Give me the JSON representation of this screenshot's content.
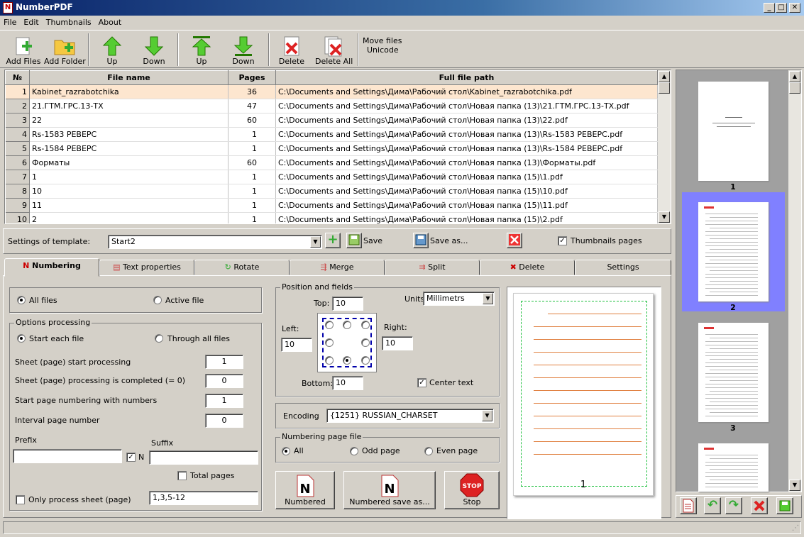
{
  "window": {
    "title": "NumberPDF",
    "min": "_",
    "max": "□",
    "close": "✕"
  },
  "menu": [
    "File",
    "Edit",
    "Thumbnails",
    "About"
  ],
  "toolbar": {
    "add_files": "Add Files",
    "add_folder": "Add Folder",
    "up1": "Up",
    "down1": "Down",
    "up2": "Up",
    "down2": "Down",
    "delete": "Delete",
    "delete_all": "Delete All",
    "move_files": "Move files",
    "unicode": "Unicode"
  },
  "grid": {
    "headers": [
      "№",
      "File name",
      "Pages",
      "Full file path"
    ],
    "rows": [
      [
        "1",
        "Kabinet_razrabotchika",
        "36",
        "C:\\Documents and Settings\\Дима\\Рабочий стол\\Kabinet_razrabotchika.pdf"
      ],
      [
        "2",
        "21.ГТМ.ГРС.13-ТХ",
        "47",
        "C:\\Documents and Settings\\Дима\\Рабочий стол\\Новая папка (13)\\21.ГТМ.ГРС.13-ТХ.pdf"
      ],
      [
        "3",
        "22",
        "60",
        "C:\\Documents and Settings\\Дима\\Рабочий стол\\Новая папка (13)\\22.pdf"
      ],
      [
        "4",
        "Rs-1583 РЕВЕРС",
        "1",
        "C:\\Documents and Settings\\Дима\\Рабочий стол\\Новая папка (13)\\Rs-1583 РЕВЕРС.pdf"
      ],
      [
        "5",
        "Rs-1584 РЕВЕРС",
        "1",
        "C:\\Documents and Settings\\Дима\\Рабочий стол\\Новая папка (13)\\Rs-1584 РЕВЕРС.pdf"
      ],
      [
        "6",
        "Форматы",
        "60",
        "C:\\Documents and Settings\\Дима\\Рабочий стол\\Новая папка (13)\\Форматы.pdf"
      ],
      [
        "7",
        "1",
        "1",
        "C:\\Documents and Settings\\Дима\\Рабочий стол\\Новая папка (15)\\1.pdf"
      ],
      [
        "8",
        "10",
        "1",
        "C:\\Documents and Settings\\Дима\\Рабочий стол\\Новая папка (15)\\10.pdf"
      ],
      [
        "9",
        "11",
        "1",
        "C:\\Documents and Settings\\Дима\\Рабочий стол\\Новая папка (15)\\11.pdf"
      ],
      [
        "10",
        "2",
        "1",
        "C:\\Documents and Settings\\Дима\\Рабочий стол\\Новая папка (15)\\2.pdf"
      ]
    ]
  },
  "template": {
    "label": "Settings of template:",
    "value": "Start2",
    "save": "Save",
    "save_as": "Save as...",
    "thumbnails_pages": "Thumbnails pages"
  },
  "tabs": [
    "Numbering",
    "Text properties",
    "Rotate",
    "Merge",
    "Split",
    "Delete",
    "Settings"
  ],
  "numbering": {
    "all_files": "All files",
    "active_file": "Active file",
    "options_processing": "Options processing",
    "start_each": "Start each file",
    "through_all": "Through all files",
    "sheet_start_label": "Sheet (page) start processing",
    "sheet_start": "1",
    "sheet_end_label": "Sheet (page) processing is completed (= 0)",
    "sheet_end": "0",
    "start_num_label": "Start page numbering with numbers",
    "start_num": "1",
    "interval_label": "Interval page number",
    "interval": "0",
    "prefix": "Prefix",
    "suffix": "Suffix",
    "n": "N",
    "total_pages": "Total pages",
    "only_process": "Only process sheet (page)",
    "only_value": "1,3,5-12"
  },
  "position": {
    "title": "Position and fields",
    "top_label": "Top:",
    "top": "10",
    "left_label": "Left:",
    "left": "10",
    "right_label": "Right:",
    "right": "10",
    "bottom_label": "Bottom:",
    "bottom": "10",
    "units_label": "Units",
    "units": "Millimetrs",
    "center_text": "Center text"
  },
  "encoding": {
    "label": "Encoding",
    "value": "{1251} RUSSIAN_CHARSET"
  },
  "numbering_page_file": {
    "title": "Numbering page file",
    "all": "All",
    "odd": "Odd page",
    "even": "Even page"
  },
  "actions": {
    "numbered": "Numbered",
    "numbered_save_as": "Numbered save as...",
    "stop": "Stop",
    "stop_sign": "STOP"
  },
  "preview": {
    "page_number": "1"
  },
  "thumbs": [
    "1",
    "2",
    "3"
  ],
  "colors": {
    "accent": "#0a246a",
    "selection_thumb": "#8080ff",
    "row_select": "#fde6cf",
    "preview_line": "#e08040",
    "preview_border": "#20c040"
  }
}
